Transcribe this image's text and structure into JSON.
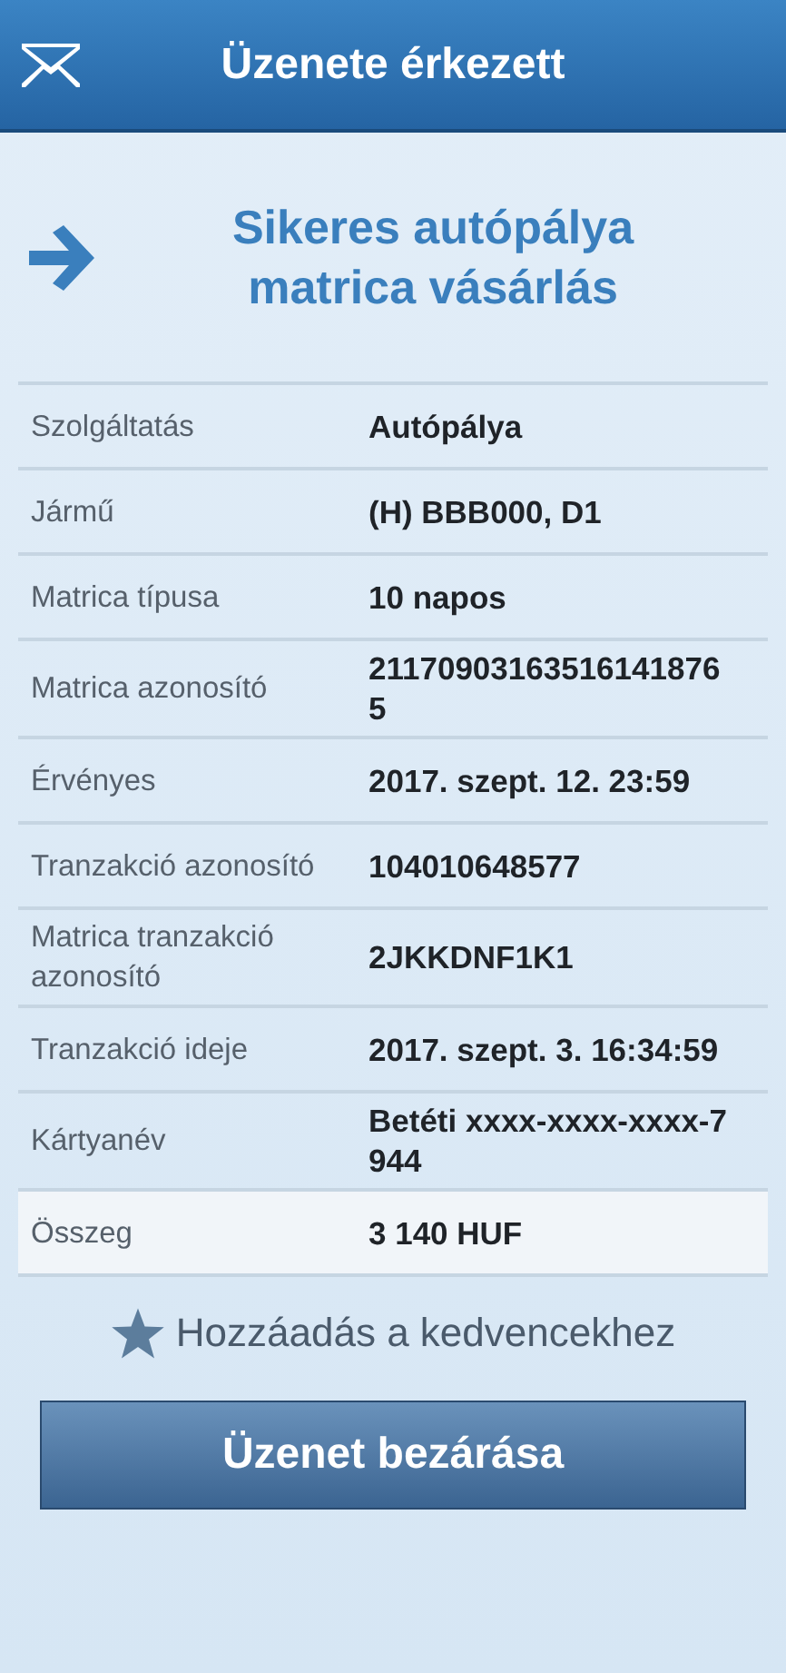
{
  "header": {
    "title": "Üzenete érkezett"
  },
  "heading": "Sikeres autópálya matrica vásárlás",
  "rows": [
    {
      "label": "Szolgáltatás",
      "value": "Autópálya",
      "highlighted": false
    },
    {
      "label": "Jármű",
      "value": "(H) BBB000, D1",
      "highlighted": false
    },
    {
      "label": "Matrica típusa",
      "value": "10 napos",
      "highlighted": false
    },
    {
      "label": "Matrica azonosító",
      "value": "211709031635161418765",
      "highlighted": false
    },
    {
      "label": "Érvényes",
      "value": "2017. szept. 12. 23:59",
      "highlighted": false
    },
    {
      "label": "Tranzakció azonosító",
      "value": "104010648577",
      "highlighted": false
    },
    {
      "label": "Matrica tranzakció azonosító",
      "value": "2JKKDNF1K1",
      "highlighted": false
    },
    {
      "label": "Tranzakció ideje",
      "value": "2017. szept. 3. 16:34:59",
      "highlighted": false
    },
    {
      "label": "Kártyanév",
      "value": "Betéti xxxx-xxxx-xxxx-7944",
      "highlighted": false
    },
    {
      "label": "Összeg",
      "value": "3 140 HUF",
      "highlighted": true
    }
  ],
  "favorite_link": "Hozzáadás a kedvencekhez",
  "close_button": "Üzenet bezárása"
}
